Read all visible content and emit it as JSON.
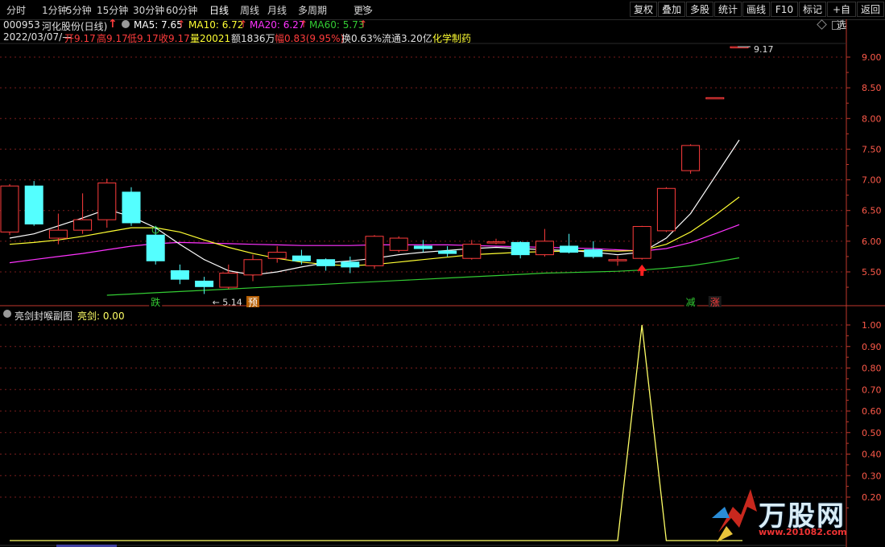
{
  "toolbar": {
    "periods": [
      "分时",
      "1分钟",
      "5分钟",
      "15分钟",
      "30分钟",
      "60分钟",
      "日线",
      "周线",
      "月线",
      "多周期",
      "更多"
    ],
    "active": "日线",
    "more_glyph": "›",
    "right_buttons": [
      "复权",
      "叠加",
      "多股",
      "统计",
      "画线",
      "F10",
      "标记",
      "+自选",
      "返回"
    ]
  },
  "info": {
    "code": "000953",
    "name": "河化股份",
    "period": "(日线)",
    "ma5_label": "MA5: 7.65",
    "ma10_label": "MA10: 6.72",
    "ma20_label": "MA20: 6.27",
    "ma60_label": "MA60: 5.73",
    "date": "2022/03/07/—",
    "open": "开9.17",
    "high": "高9.17",
    "low": "低9.17",
    "close": "收9.17",
    "volume": "量20021",
    "amount": "额1836万",
    "change": "幅0.83(9.95%)",
    "turnover": "换0.63%",
    "float": "流通3.20亿",
    "sector": "化学制药",
    "up_arrow": "↑"
  },
  "indicator": {
    "title": "亮剑封喉副图",
    "value_label": "亮剑: 0.00"
  },
  "logo": {
    "text": "万股网",
    "url": "www.201082.com"
  },
  "colors": {
    "up": "#ff3c3c",
    "down": "#54ffff",
    "ma5": "#ffffff",
    "ma10": "#ffff33",
    "ma20": "#ff33ff",
    "ma60": "#33cc33",
    "axis": "#c0392b",
    "grid": "#7a1d1d",
    "signal": "#ffff66"
  },
  "chart_data": [
    {
      "type": "candlestick",
      "ylim": [
        5.14,
        9.3
      ],
      "yticks": [
        "9.00",
        "8.50",
        "8.00",
        "7.50",
        "7.00",
        "6.50",
        "6.00",
        "5.50"
      ],
      "candles": [
        {
          "o": 6.15,
          "h": 6.93,
          "l": 6.1,
          "c": 6.9
        },
        {
          "o": 6.9,
          "h": 6.98,
          "l": 6.25,
          "c": 6.28
        },
        {
          "o": 6.05,
          "h": 6.45,
          "l": 5.95,
          "c": 6.18
        },
        {
          "o": 6.18,
          "h": 6.78,
          "l": 6.12,
          "c": 6.35
        },
        {
          "o": 6.35,
          "h": 7.02,
          "l": 6.22,
          "c": 6.95
        },
        {
          "o": 6.8,
          "h": 6.88,
          "l": 6.25,
          "c": 6.3
        },
        {
          "o": 6.1,
          "h": 6.25,
          "l": 5.62,
          "c": 5.68
        },
        {
          "o": 5.52,
          "h": 5.62,
          "l": 5.3,
          "c": 5.38
        },
        {
          "o": 5.35,
          "h": 5.42,
          "l": 5.14,
          "c": 5.26
        },
        {
          "o": 5.25,
          "h": 5.62,
          "l": 5.22,
          "c": 5.48
        },
        {
          "o": 5.45,
          "h": 5.78,
          "l": 5.35,
          "c": 5.7
        },
        {
          "o": 5.72,
          "h": 5.92,
          "l": 5.65,
          "c": 5.82
        },
        {
          "o": 5.76,
          "h": 5.86,
          "l": 5.62,
          "c": 5.68
        },
        {
          "o": 5.7,
          "h": 5.72,
          "l": 5.52,
          "c": 5.6
        },
        {
          "o": 5.66,
          "h": 5.75,
          "l": 5.48,
          "c": 5.58
        },
        {
          "o": 5.6,
          "h": 6.1,
          "l": 5.55,
          "c": 6.08
        },
        {
          "o": 5.85,
          "h": 6.08,
          "l": 5.82,
          "c": 6.05
        },
        {
          "o": 5.92,
          "h": 6.02,
          "l": 5.82,
          "c": 5.88
        },
        {
          "o": 5.84,
          "h": 5.92,
          "l": 5.75,
          "c": 5.8
        },
        {
          "o": 5.72,
          "h": 6.02,
          "l": 5.7,
          "c": 5.95
        },
        {
          "o": 5.99,
          "h": 6.04,
          "l": 5.95,
          "c": 5.99
        },
        {
          "o": 5.98,
          "h": 6.0,
          "l": 5.72,
          "c": 5.78
        },
        {
          "o": 5.78,
          "h": 6.2,
          "l": 5.75,
          "c": 6.0
        },
        {
          "o": 5.92,
          "h": 6.12,
          "l": 5.8,
          "c": 5.82
        },
        {
          "o": 5.86,
          "h": 6.0,
          "l": 5.72,
          "c": 5.75
        },
        {
          "o": 5.7,
          "h": 5.76,
          "l": 5.6,
          "c": 5.7
        },
        {
          "o": 5.72,
          "h": 6.25,
          "l": 5.7,
          "c": 6.24
        },
        {
          "o": 6.17,
          "h": 6.88,
          "l": 6.15,
          "c": 6.86
        },
        {
          "o": 7.15,
          "h": 7.58,
          "l": 7.1,
          "c": 7.56
        },
        {
          "o": 8.34,
          "h": 8.34,
          "l": 8.34,
          "c": 8.34
        },
        {
          "o": 9.17,
          "h": 9.17,
          "l": 9.17,
          "c": 9.17
        }
      ],
      "ma5": [
        6.05,
        6.12,
        6.25,
        6.38,
        6.52,
        6.4,
        6.22,
        5.95,
        5.7,
        5.52,
        5.45,
        5.5,
        5.58,
        5.65,
        5.68,
        5.72,
        5.78,
        5.82,
        5.85,
        5.88,
        5.9,
        5.88,
        5.86,
        5.85,
        5.82,
        5.78,
        5.82,
        6.05,
        6.45,
        7.05,
        7.65
      ],
      "ma10": [
        5.95,
        5.98,
        6.02,
        6.08,
        6.15,
        6.22,
        6.22,
        6.15,
        6.02,
        5.9,
        5.8,
        5.72,
        5.66,
        5.62,
        5.6,
        5.62,
        5.66,
        5.7,
        5.74,
        5.78,
        5.8,
        5.82,
        5.83,
        5.84,
        5.85,
        5.84,
        5.85,
        5.95,
        6.15,
        6.42,
        6.72
      ],
      "ma20": [
        5.65,
        5.7,
        5.75,
        5.8,
        5.86,
        5.92,
        5.96,
        5.98,
        5.97,
        5.96,
        5.95,
        5.94,
        5.93,
        5.93,
        5.93,
        5.94,
        5.94,
        5.94,
        5.94,
        5.93,
        5.92,
        5.91,
        5.9,
        5.89,
        5.88,
        5.86,
        5.84,
        5.88,
        5.98,
        6.12,
        6.27
      ],
      "ma60": [
        null,
        null,
        null,
        null,
        5.12,
        5.14,
        5.16,
        5.18,
        5.2,
        5.22,
        5.24,
        5.26,
        5.28,
        5.3,
        5.32,
        5.34,
        5.36,
        5.38,
        5.4,
        5.42,
        5.44,
        5.46,
        5.48,
        5.49,
        5.5,
        5.51,
        5.53,
        5.56,
        5.6,
        5.66,
        5.73
      ],
      "labels": {
        "low": "5.14",
        "high": "9.17"
      },
      "markers": [
        {
          "i": 6,
          "text": "跌",
          "color": "#33cc33",
          "bg": "#000"
        },
        {
          "i": 10,
          "text": "预",
          "color": "#ffffff",
          "bg": "#b35c00"
        },
        {
          "i": 28,
          "text": "减",
          "color": "#33cc33",
          "bg": "#000"
        },
        {
          "i": 29,
          "text": "涨",
          "color": "#ff3c3c",
          "bg": "#1a1a1a"
        }
      ]
    },
    {
      "type": "line",
      "title": "亮剑",
      "ylim": [
        0.12,
        1.05
      ],
      "yticks": [
        "1.00",
        "0.90",
        "0.80",
        "0.70",
        "0.60",
        "0.50",
        "0.40",
        "0.30",
        "0.20"
      ],
      "values": [
        0,
        0,
        0,
        0,
        0,
        0,
        0,
        0,
        0,
        0,
        0,
        0,
        0,
        0,
        0,
        0,
        0,
        0,
        0,
        0,
        0,
        0,
        0,
        0,
        0,
        0,
        1,
        0,
        0,
        0,
        0
      ]
    }
  ]
}
